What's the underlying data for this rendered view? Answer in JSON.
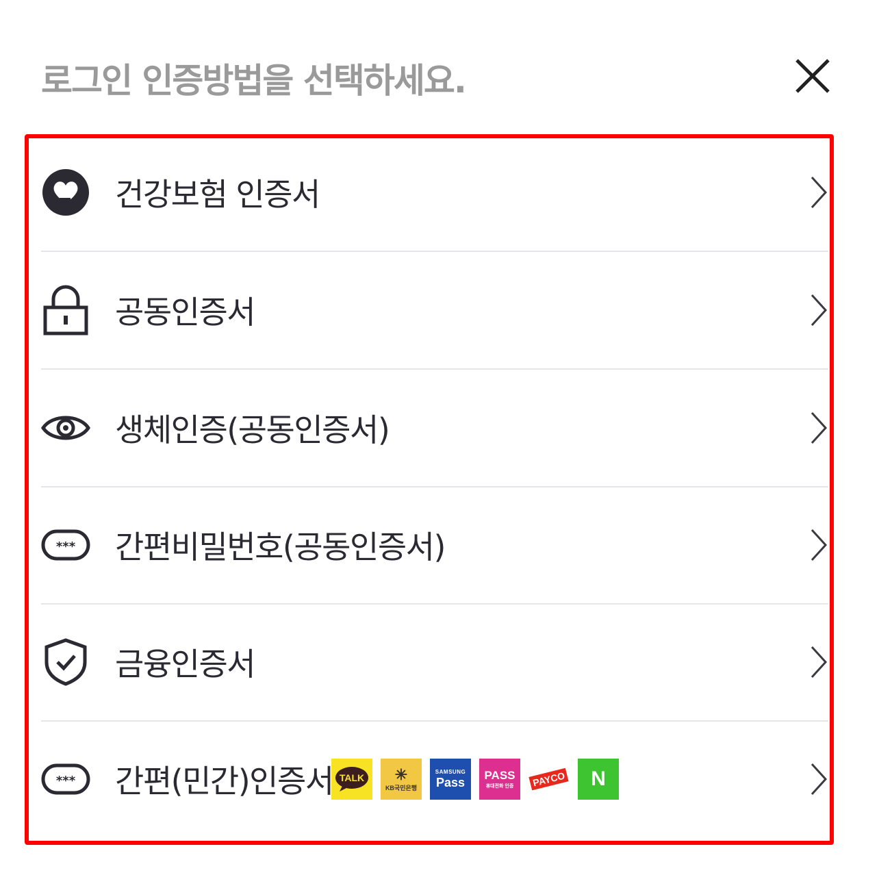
{
  "modal": {
    "title": "로그인 인증방법을 선택하세요.",
    "close_icon": "close-icon"
  },
  "colors": {
    "highlight_border": "#ff0000",
    "title_text": "#9a9a9a",
    "label_text": "#2b2a33",
    "divider": "#e6e6ea"
  },
  "methods": [
    {
      "label": "건강보험 인증서",
      "icon": "health-insurance-icon"
    },
    {
      "label": "공동인증서",
      "icon": "lock-icon"
    },
    {
      "label": "생체인증(공동인증서)",
      "icon": "eye-icon"
    },
    {
      "label": "간편비밀번호(공동인증서)",
      "icon": "password-dots-icon"
    },
    {
      "label": "금융인증서",
      "icon": "shield-check-icon"
    },
    {
      "label": "간편(민간)인증서",
      "icon": "password-dots-icon"
    }
  ],
  "simple_auth_logos": [
    {
      "name": "kakao-talk",
      "text": "TALK",
      "bg": "#f7e324",
      "fg": "#3c1e1e"
    },
    {
      "name": "kb-bank",
      "text": "KB국민은행",
      "bg": "#f2c744",
      "fg": "#3b3226"
    },
    {
      "name": "samsung-pass",
      "top": "SAMSUNG",
      "text": "Pass",
      "bg": "#1f4fae",
      "fg": "#ffffff"
    },
    {
      "name": "pass",
      "text": "PASS",
      "sub": "휴대전화 인증",
      "bg": "#dd2f8f",
      "fg": "#ffffff"
    },
    {
      "name": "payco",
      "text": "PAYCO",
      "bg": "#ffffff",
      "fg": "#e8281c"
    },
    {
      "name": "naver",
      "text": "N",
      "bg": "#3fc431",
      "fg": "#ffffff"
    }
  ]
}
